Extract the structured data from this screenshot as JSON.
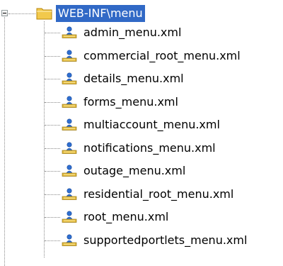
{
  "tree": {
    "root": {
      "label": "WEB-INF\\menu",
      "expanded": true,
      "selected": true,
      "icon": "folder-icon"
    },
    "files": [
      {
        "label": "admin_menu.xml",
        "icon": "xml-file-icon"
      },
      {
        "label": "commercial_root_menu.xml",
        "icon": "xml-file-icon"
      },
      {
        "label": "details_menu.xml",
        "icon": "xml-file-icon"
      },
      {
        "label": "forms_menu.xml",
        "icon": "xml-file-icon"
      },
      {
        "label": "multiaccount_menu.xml",
        "icon": "xml-file-icon"
      },
      {
        "label": "notifications_menu.xml",
        "icon": "xml-file-icon"
      },
      {
        "label": "outage_menu.xml",
        "icon": "xml-file-icon"
      },
      {
        "label": "residential_root_menu.xml",
        "icon": "xml-file-icon"
      },
      {
        "label": "root_menu.xml",
        "icon": "xml-file-icon"
      },
      {
        "label": "supportedportlets_menu.xml",
        "icon": "xml-file-icon"
      }
    ]
  },
  "colors": {
    "selection": "#3169c6",
    "selection_text": "#ffffff",
    "folder": "#f2c94c",
    "tree_lines": "#8a8a8a"
  }
}
